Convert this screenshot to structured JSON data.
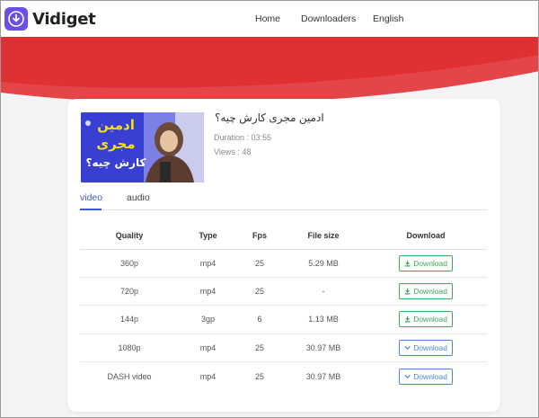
{
  "app": {
    "name": "Vidiget"
  },
  "nav": {
    "items": [
      "Home",
      "Downloaders",
      "English"
    ]
  },
  "video": {
    "title": "ادمین مجری کارش چیه؟",
    "thumbnail_text": [
      "ادمین",
      "مجری",
      "کارش چیه؟"
    ],
    "duration": "Duration : 03:55",
    "views": "Views : 48"
  },
  "tabs": [
    {
      "label": "video",
      "active": true
    },
    {
      "label": "audio",
      "active": false
    }
  ],
  "table": {
    "headers": [
      "Quality",
      "Type",
      "Fps",
      "File size",
      "Download"
    ],
    "rows": [
      {
        "quality": "360p",
        "type": "mp4",
        "fps": "25",
        "size": "5.29 MB",
        "download": "Download",
        "style": "direct"
      },
      {
        "quality": "720p",
        "type": "mp4",
        "fps": "25",
        "size": "-",
        "download": "Download",
        "style": "direct"
      },
      {
        "quality": "144p",
        "type": "3gp",
        "fps": "6",
        "size": "1.13 MB",
        "download": "Download",
        "style": "direct"
      },
      {
        "quality": "1080p",
        "type": "mp4",
        "fps": "25",
        "size": "30.97 MB",
        "download": "Download",
        "style": "dropdown"
      },
      {
        "quality": "DASH video",
        "type": "mp4",
        "fps": "25",
        "size": "30.97 MB",
        "download": "Download",
        "style": "dropdown"
      }
    ]
  },
  "colors": {
    "brand": "#6c4de6",
    "banner": "#df3033",
    "direct": "#3aa85a",
    "dropdown": "#4b86d6",
    "active_tab": "#3b5bcc"
  }
}
